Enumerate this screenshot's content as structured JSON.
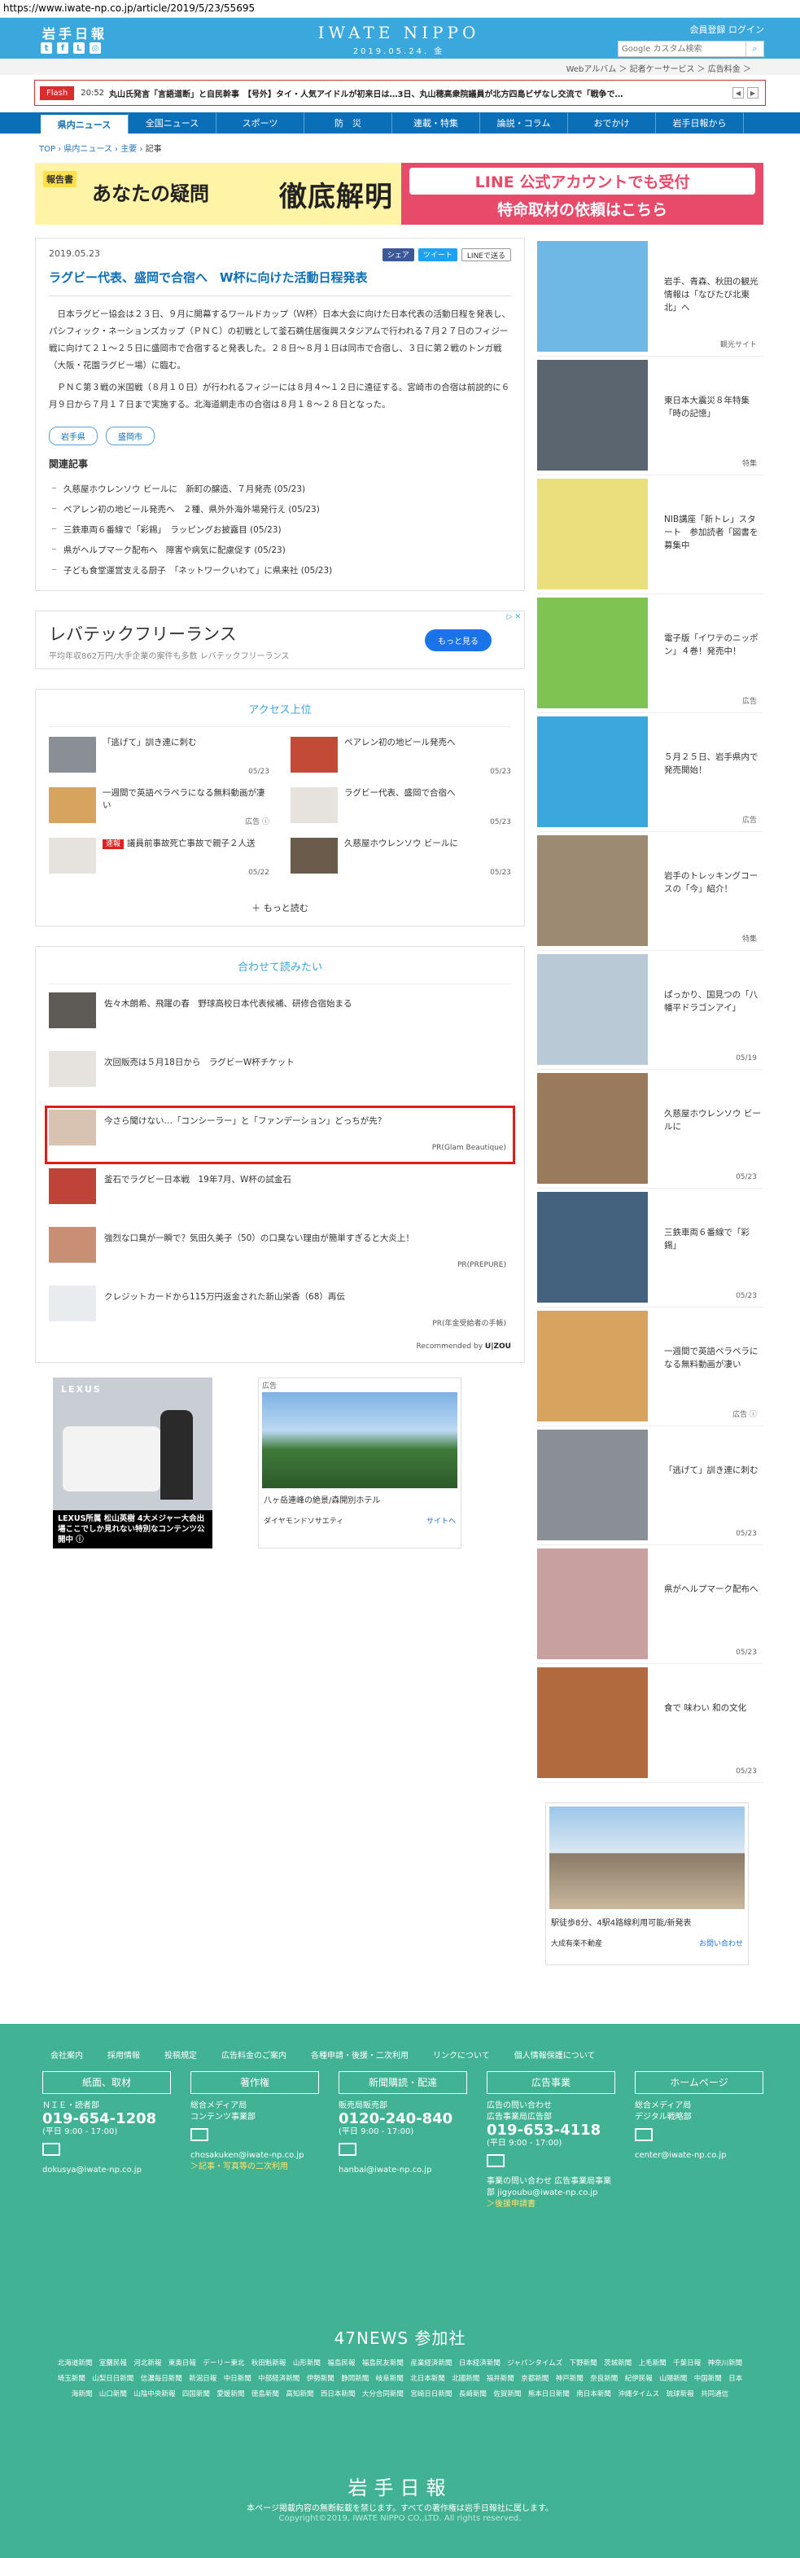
{
  "url": "https://www.iwate-np.co.jp/article/2019/5/23/55695",
  "header": {
    "logo_jp": "岩手日報",
    "logo_en": "IWATE NIPPO",
    "date": "2019.05.24. 金",
    "links": "会員登録  ログイン",
    "search_placeholder": "Google カスタム検索"
  },
  "subbar": "Webアルバム ＞   記者ケーサービス ＞   広告料金 ＞",
  "flash": {
    "label": "Flash",
    "time": "20:52",
    "text": "丸山氏発言「言語道断」と自民幹事　【号外】タイ・人気アイドルが初来日は…3日、丸山穂高衆院議員が北方四島ビザなし交流で「戦争で…"
  },
  "nav": [
    "県内ニュース",
    "全国ニュース",
    "スポーツ",
    "防　災",
    "連載・特集",
    "論説・コラム",
    "おでかけ",
    "岩手日報から"
  ],
  "breadcrumb": {
    "top": "TOP",
    "sep1": " › ",
    "b1": "県内ニュース",
    "sep2": " › ",
    "b2": "主要",
    "sep3": " › ",
    "cur": "記事"
  },
  "banner": {
    "tag": "報告書",
    "title1": "あなたの疑問",
    "title2": "徹底解明",
    "line1": "LINE 公式アカウントでも受付",
    "line2": "特命取材の依頼はこちら"
  },
  "article": {
    "date": "2019.05.23",
    "share_fb": "シェア",
    "share_tw": "ツイート",
    "share_line": "LINEで送る",
    "title": "ラグビー代表、盛岡で合宿へ　W杯に向けた活動日程発表",
    "p1": "日本ラグビー協会は２３日、９月に開幕するワールドカップ（Ｗ杯）日本大会に向けた日本代表の活動日程を発表し、パシフィック・ネーションズカップ（ＰＮＣ）の初戦として釜石鵜住居復興スタジアムで行われる７月２７日のフィジー戦に向けて２１～２５日に盛岡市で合宿すると発表した。２８日～８月１日は同市で合宿し、３日に第２戦のトンガ戦（大阪・花園ラグビー場）に臨む。",
    "p2": "ＰＮＣ第３戦の米国戦（８月１０日）が行われるフィジーには８月４～１２日に遠征する。宮崎市の合宿は前説的に６月９日から７月１７日まで実施する。北海道網走市の合宿は８月１８～２８日となった。",
    "tags": [
      "岩手県",
      "盛岡市"
    ],
    "related_head": "関連記事",
    "related": [
      "久慈屋ホウレンソウ ビールに　新町の醸造、７月発売 (05/23)",
      "ペアレン初の地ビール発売へ　２種、県外外海外場発行え (05/23)",
      "三鉄車両６番線で「彩錫」　ラッピングお披露目 (05/23)",
      "県がヘルプマーク配布へ　障害や病気に配慮促す (05/23)",
      "子ども食堂運営支える厨子　「ネットワークいわて」に県来社 (05/23)"
    ]
  },
  "ad_bar": {
    "title": "レバテックフリーランス",
    "sub": "平均年収862万円/大手企業の案件も多数 レバテックフリーランス",
    "btn": "もっと見る",
    "mark": "▷ ✕"
  },
  "access": {
    "head": "アクセス上位",
    "items": [
      {
        "text": "「逃げて」訓き連に刺む",
        "date": "05/23",
        "color": "#8a8f95"
      },
      {
        "text": "ペアレン初の地ビール発売へ",
        "date": "05/23",
        "color": "#c44a38"
      },
      {
        "text": "一週間で英語ペラペラになる無料動画が凄い",
        "date": "広告 ⓘ",
        "color": "#d7a45f"
      },
      {
        "text": "ラグビー代表、盛岡で合宿へ",
        "date": "05/23",
        "color": "#e6e2de"
      },
      {
        "text": "議員前事故死亡事故で親子２人送",
        "date": "05/22",
        "color": "#e6e2de",
        "badge": "速報"
      },
      {
        "text": "久慈屋ホウレンソウ ビールに",
        "date": "05/23",
        "color": "#6b5b4a"
      }
    ],
    "more": "＋ もっと読む"
  },
  "together": {
    "head": "合わせて読みたい",
    "items": [
      {
        "text": "佐々木朗希、飛躍の春　野球高校日本代表候補、研修合宿始まる",
        "pr": "",
        "color": "#5e5a55"
      },
      {
        "text": "次回販売は５月18日から　ラグビーW杯チケット",
        "pr": "",
        "color": "#e6e2de"
      },
      {
        "text": "今さら聞けない…「コンシーラー」と「ファンデーション」どっちが先？",
        "pr": "PR(Glam Beautique)",
        "color": "#d8c2b2"
      },
      {
        "text": "釜石でラグビー日本戦　19年7月、W杯の試金石",
        "pr": "",
        "color": "#c0433a"
      },
      {
        "text": "強烈な口臭が一瞬で？気田久美子（50）の口臭ない理由が簡単すぎると大炎上！",
        "pr": "PR(PREPURE)",
        "color": "#c98f74"
      },
      {
        "text": "クレジットカードから115万円返金された新山栄香（68）再伝",
        "pr": "PR(年金受給者の手帳)",
        "color": "#e9ecef"
      }
    ],
    "rec": "Recommended by",
    "rec_brand": "U|ZOU"
  },
  "ads": {
    "lexus_brand": "LEXUS",
    "lexus_caption": "LEXUS所属 松山英樹 4大メジャー大会出場ここでしか見れない特別なコンテンツ公開中 ⓘ",
    "hotel_label": "広告",
    "hotel_title": "八ヶ岳連峰の絶景/森開別ホテル",
    "hotel_brand": "ダイヤモンドソサエティ",
    "hotel_site": "サイトへ"
  },
  "side": {
    "items": [
      {
        "text": "岩手、青森、秋田の観光情報は「なびたび北東北」へ",
        "cap": "観光サイト",
        "color": "#6fb8e6"
      },
      {
        "text": "東日本大震災８年特集「時の記憶」",
        "cap": "特集",
        "color": "#5a6570"
      },
      {
        "text": "NIB講座「新トレ」スタート　参加読者「図書を募集中",
        "cap": "",
        "color": "#e9df7c"
      },
      {
        "text": "電子版「イワテのニッポン」４巻！発売中！",
        "cap": "広告",
        "color": "#7fc452"
      },
      {
        "text": "５月２５日、岩手県内で発売開始！",
        "cap": "広告",
        "color": "#3aa7dd"
      },
      {
        "text": "岩手のトレッキングコースの「今」紹介！",
        "cap": "特集",
        "color": "#9c8a72"
      },
      {
        "text": "ぱっかり、国見つの「八幡平ドラゴンアイ」",
        "cap": "05/19",
        "color": "#b9c9d6"
      },
      {
        "text": "久慈屋ホウレンソウ ビールに",
        "cap": "05/23",
        "color": "#9a7a5c"
      },
      {
        "text": "三鉄車両６番線で「彩錫」",
        "cap": "05/23",
        "color": "#44627e"
      },
      {
        "text": "一週間で英語ペラペラになる無料動画が凄い",
        "cap": "広告 ⓘ",
        "color": "#d7a45f"
      },
      {
        "text": "「逃げて」訓き連に刺む",
        "cap": "05/23",
        "color": "#8a8f95"
      },
      {
        "text": "県がヘルプマーク配布へ",
        "cap": "05/23",
        "color": "#c9a0a0"
      },
      {
        "text": "食で 味わい 和の文化",
        "cap": "05/23",
        "color": "#b06a3e"
      }
    ],
    "ad_title": "駅徒歩8分、4駅4路線利用可能/新発表",
    "ad_brand": "大成有楽不動産",
    "ad_site": "お問い合わせ"
  },
  "footer": {
    "links": [
      "会社案内",
      "採用情報",
      "投稿規定",
      "広告料金のご案内",
      "各種申請・後援・二次利用",
      "リンクについて",
      "個人情報保護について"
    ],
    "cols": [
      {
        "head": "紙面、取材",
        "l1": "ＮＩＥ・読者部",
        "tel": "019-654-1208",
        "l2": "(平日 9:00 - 17:00)",
        "mail": "dokusya@iwate-np.co.jp",
        "link": ""
      },
      {
        "head": "著作権",
        "l1": "総合メディア局\nコンテンツ事業部",
        "tel": "",
        "l2": "",
        "mail": "chosakuken@iwate-np.co.jp",
        "link": "＞記事・写真等の二次利用"
      },
      {
        "head": "新聞購読・配達",
        "l1": "販売局販売部",
        "tel": "0120-240-840",
        "l2": "(平日 9:00 - 17:00)",
        "mail": "hanbai@iwate-np.co.jp",
        "link": ""
      },
      {
        "head": "広告事業",
        "l1": "広告の問い合わせ\n広告事業局広告部",
        "tel": "019-653-4118",
        "l2": "(平日 9:00 - 17:00)",
        "mail": "事業の問い合わせ 広告事業局事業部 jigyoubu@iwate-np.co.jp",
        "link": "＞後援申請書"
      },
      {
        "head": "ホームページ",
        "l1": "総合メディア局\nデジタル戦略部",
        "tel": "",
        "l2": "",
        "mail": "center@iwate-np.co.jp",
        "link": ""
      }
    ],
    "news47": "47NEWS 参加社",
    "papers": "北海道新聞　室蘭民報　河北新報　東奥日報　デーリー東北　秋田魁新報　山形新聞　福島民報　福島民友新聞　産業経済新聞　日本経済新聞　ジャパンタイムズ　下野新聞　茨城新聞　上毛新聞　千葉日報　神奈川新聞　埼玉新聞　山梨日日新聞　信濃毎日新聞　新潟日報　中日新聞　中部経済新聞　伊勢新聞　静岡新聞　岐阜新聞　北日本新聞　北國新聞　福井新聞　京都新聞　神戸新聞　奈良新聞　紀伊民報　山陽新聞　中国新聞　日本海新聞　山口新聞　山陰中央新報　四国新聞　愛媛新聞　徳島新聞　高知新聞　西日本新聞　大分合同新聞　宮崎日日新聞　長崎新聞　佐賀新聞　熊本日日新聞　南日本新聞　沖縄タイムス　琉球新報　共同通信",
    "logo": "岩手日報",
    "note": "本ページ掲載内容の無断転載を禁じます。すべての著作権は岩手日報社に属します。",
    "copy": "Copyright©2019, IWATE NIPPO CO.,LTD. All rights reserved."
  }
}
